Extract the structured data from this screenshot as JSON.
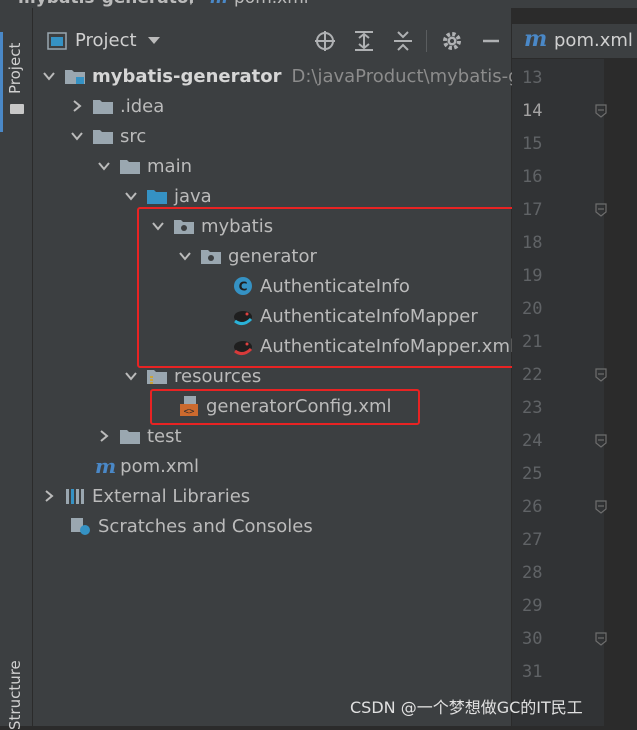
{
  "window": {
    "breadcrumb_project": "mybatis-generator",
    "breadcrumb_file": "pom.xml"
  },
  "side_tabs": {
    "project": "Project",
    "structure": "Structure"
  },
  "panel": {
    "title": "Project",
    "toolbar_icons": [
      "locate-icon",
      "expand-all-icon",
      "collapse-all-icon",
      "gear-icon",
      "minimize-icon"
    ]
  },
  "tree": {
    "root": {
      "name": "mybatis-generator",
      "path": "D:\\javaProduct\\mybatis-gen"
    },
    "idea": ".idea",
    "src": "src",
    "main": "main",
    "java": "java",
    "mybatis": "mybatis",
    "generator": "generator",
    "authenticate_info": "AuthenticateInfo",
    "authenticate_info_mapper": "AuthenticateInfoMapper",
    "authenticate_info_mapper_xml": "AuthenticateInfoMapper.xml",
    "resources": "resources",
    "generator_config": "generatorConfig.xml",
    "test": "test",
    "pom": "pom.xml",
    "external_libraries": "External Libraries",
    "scratches": "Scratches and Consoles"
  },
  "editor": {
    "tab_label": "pom.xml",
    "current_line": "14",
    "line_numbers": [
      "13",
      "14",
      "15",
      "16",
      "17",
      "18",
      "19",
      "20",
      "21",
      "22",
      "23",
      "24",
      "25",
      "26",
      "27",
      "28",
      "29",
      "30",
      "31"
    ]
  },
  "watermark": "CSDN @一个梦想做GC的IT民工",
  "colors": {
    "highlight_box": "#e82323",
    "folder_blue": "#3592c4",
    "class_icon": "#3592c4"
  }
}
